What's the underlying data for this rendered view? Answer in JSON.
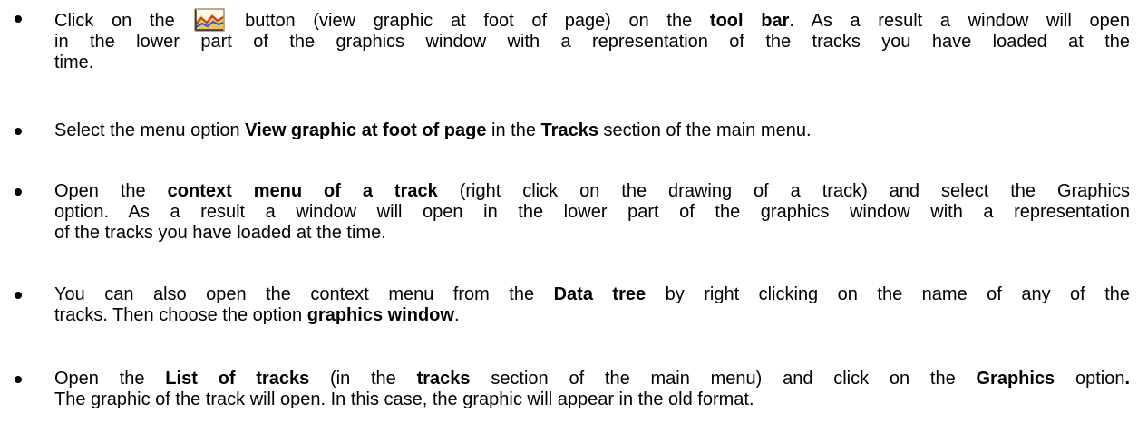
{
  "items": [
    {
      "line1": {
        "a": "Click on the",
        "b": "button (view graphic at foot of page) on the",
        "bold": "tool bar",
        "c": ". As a result a window will open"
      },
      "line2": "in the lower part of the graphics window with a representation of the tracks you have loaded at the",
      "line3": "time.",
      "icon": "view-graphic-icon"
    },
    {
      "a": "Select the menu option",
      "bold1": "View graphic at foot of page",
      "b": "in the",
      "bold2": "Tracks",
      "c": "section of the main menu."
    },
    {
      "line1": {
        "a": "Open the",
        "bold": "context menu of a track",
        "b": "(right click on the drawing of a track) and select the Graphics"
      },
      "line2": "option. As a result a window will open in the lower part of the graphics window with a representation",
      "line3": "of the tracks you have loaded at the time."
    },
    {
      "line1": {
        "a": "You can also open the context menu from the",
        "bold": "Data tree",
        "b": "by right clicking on the name of any of the"
      },
      "line2": {
        "a": "tracks. Then choose the option",
        "bold": "graphics window",
        "b": "."
      }
    },
    {
      "line1": {
        "a": "Open the",
        "bold1": "List of tracks",
        "b": "(in the",
        "bold2": "tracks",
        "c": "section of the main menu) and click on the",
        "bold3": "Graphics",
        "d": "option",
        "bold4": "."
      },
      "line2": "The graphic of the track will open. In this case, the graphic will appear in the old format."
    }
  ]
}
